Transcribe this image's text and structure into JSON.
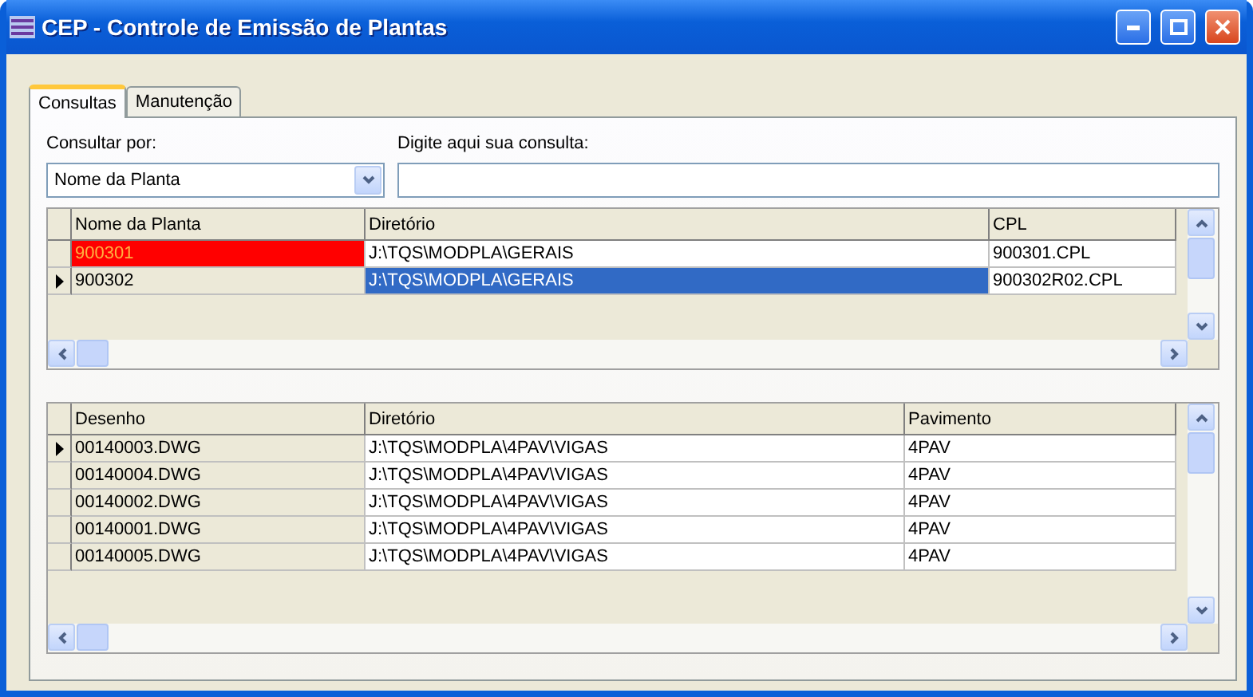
{
  "window": {
    "title": "CEP - Controle de Emissão de Plantas"
  },
  "tabs": [
    {
      "label": "Consultas",
      "selected": true
    },
    {
      "label": "Manutenção",
      "selected": false
    }
  ],
  "search_by": {
    "label": "Consultar por:",
    "value": "Nome da Planta"
  },
  "query": {
    "label": "Digite aqui sua consulta:"
  },
  "plants_grid": {
    "columns": [
      "Nome da Planta",
      "Diretório",
      "CPL"
    ],
    "rows": [
      {
        "cells": [
          "900301",
          "J:\\TQS\\MODPLA\\GERAIS",
          "900301.CPL"
        ],
        "selected": false,
        "highlighted": true
      },
      {
        "cells": [
          "900302",
          "J:\\TQS\\MODPLA\\GERAIS",
          "900302R02.CPL"
        ],
        "selected": true,
        "highlighted": false
      }
    ]
  },
  "drawings_grid": {
    "columns": [
      "Desenho",
      "Diretório",
      "Pavimento"
    ],
    "rows": [
      {
        "cells": [
          "00140003.DWG",
          "J:\\TQS\\MODPLA\\4PAV\\VIGAS",
          "4PAV"
        ],
        "selected": true,
        "highlighted": false
      },
      {
        "cells": [
          "00140004.DWG",
          "J:\\TQS\\MODPLA\\4PAV\\VIGAS",
          "4PAV"
        ],
        "selected": false,
        "highlighted": false
      },
      {
        "cells": [
          "00140002.DWG",
          "J:\\TQS\\MODPLA\\4PAV\\VIGAS",
          "4PAV"
        ],
        "selected": false,
        "highlighted": false
      },
      {
        "cells": [
          "00140001.DWG",
          "J:\\TQS\\MODPLA\\4PAV\\VIGAS",
          "4PAV"
        ],
        "selected": false,
        "highlighted": false
      },
      {
        "cells": [
          "00140005.DWG",
          "J:\\TQS\\MODPLA\\4PAV\\VIGAS",
          "4PAV"
        ],
        "selected": false,
        "highlighted": false
      }
    ]
  }
}
